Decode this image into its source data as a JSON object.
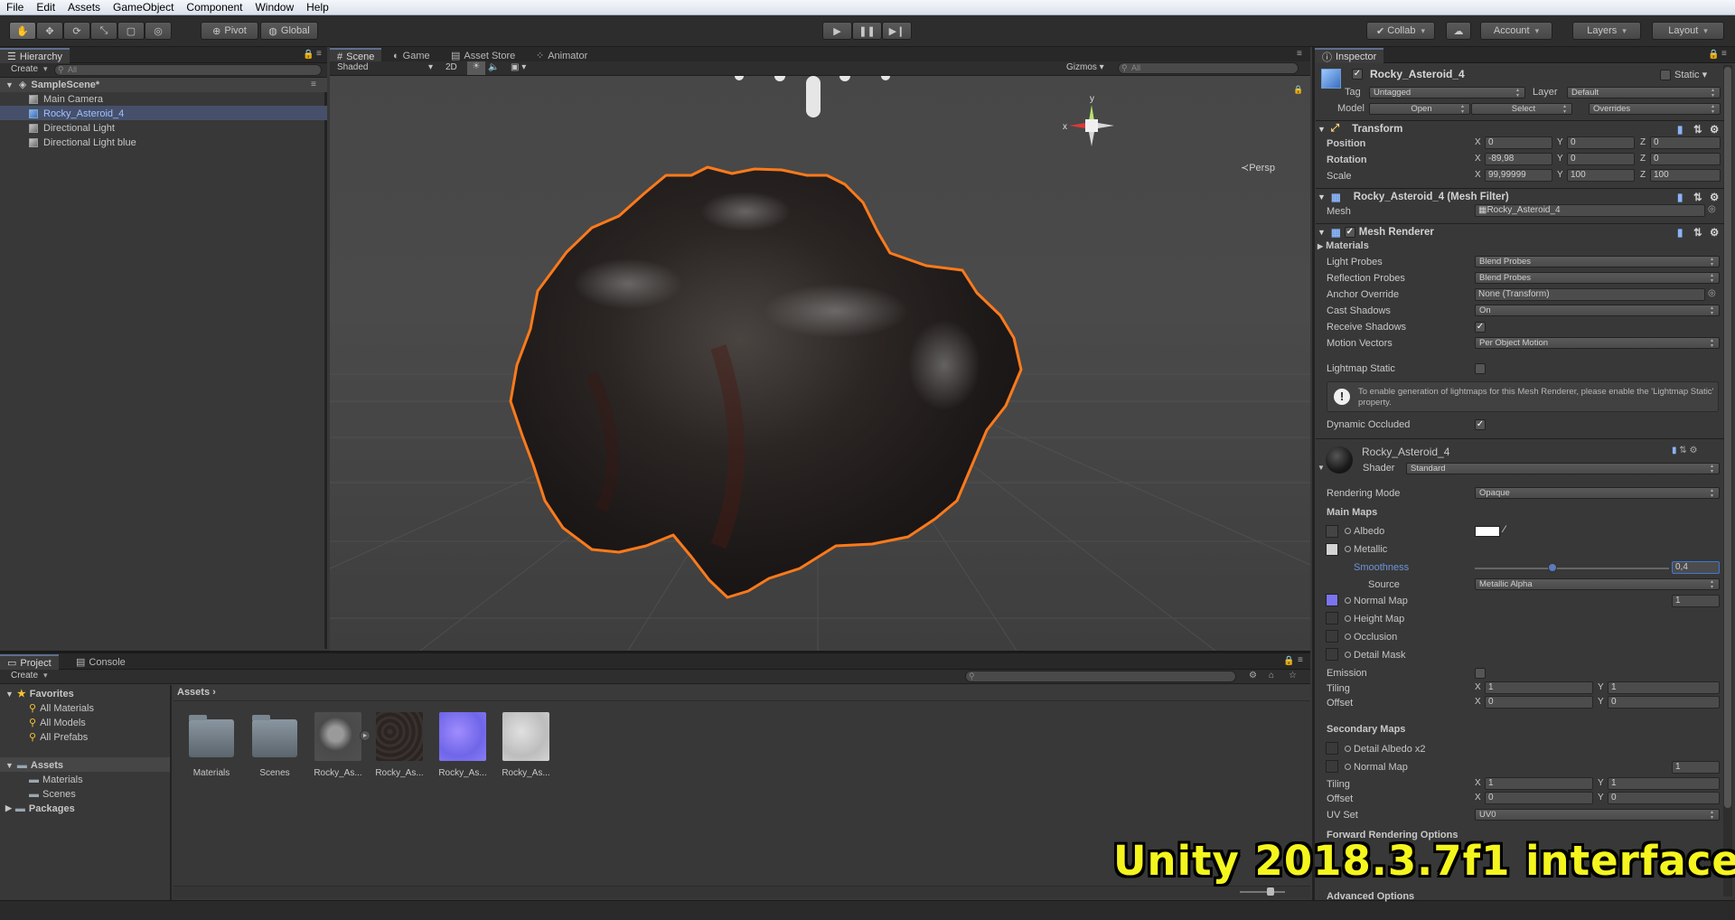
{
  "menu": [
    "File",
    "Edit",
    "Assets",
    "GameObject",
    "Component",
    "Window",
    "Help"
  ],
  "toolbar": {
    "pivot": "Pivot",
    "global": "Global",
    "collab": "Collab",
    "account": "Account",
    "layers": "Layers",
    "layout": "Layout"
  },
  "hierarchy": {
    "tab": "Hierarchy",
    "create": "Create",
    "search_placeholder": "All",
    "scene": "SampleScene*",
    "items": [
      "Main Camera",
      "Rocky_Asteroid_4",
      "Directional Light",
      "Directional Light blue"
    ]
  },
  "scene_tabs": [
    "Scene",
    "Game",
    "Asset Store",
    "Animator"
  ],
  "scene_bar": {
    "shading": "Shaded",
    "mode_2d": "2D",
    "gizmos": "Gizmos",
    "search_placeholder": "All",
    "persp": "Persp",
    "axis_x": "x",
    "axis_y": "y"
  },
  "project": {
    "tabs": [
      "Project",
      "Console"
    ],
    "create": "Create",
    "favorites_label": "Favorites",
    "favorites": [
      "All Materials",
      "All Models",
      "All Prefabs"
    ],
    "assets_label": "Assets",
    "asset_folders": [
      "Materials",
      "Scenes"
    ],
    "packages_label": "Packages",
    "breadcrumb": "Assets",
    "assets": [
      "Materials",
      "Scenes",
      "Rocky_As...",
      "Rocky_As...",
      "Rocky_As...",
      "Rocky_As..."
    ]
  },
  "inspector": {
    "tab": "Inspector",
    "object_name": "Rocky_Asteroid_4",
    "static_label": "Static",
    "tag_label": "Tag",
    "tag_value": "Untagged",
    "layer_label": "Layer",
    "layer_value": "Default",
    "model_label": "Model",
    "model_open": "Open",
    "model_select": "Select",
    "model_overrides": "Overrides",
    "transform": {
      "title": "Transform",
      "position_label": "Position",
      "position": [
        "0",
        "0",
        "0"
      ],
      "rotation_label": "Rotation",
      "rotation": [
        "-89,98",
        "0",
        "0"
      ],
      "scale_label": "Scale",
      "scale": [
        "99,99999",
        "100",
        "100"
      ]
    },
    "mesh_filter": {
      "title": "Rocky_Asteroid_4 (Mesh Filter)",
      "mesh_label": "Mesh",
      "mesh_value": "Rocky_Asteroid_4"
    },
    "mesh_renderer": {
      "title": "Mesh Renderer",
      "materials_label": "Materials",
      "light_probes_label": "Light Probes",
      "light_probes": "Blend Probes",
      "reflection_probes_label": "Reflection Probes",
      "reflection_probes": "Blend Probes",
      "anchor_override_label": "Anchor Override",
      "anchor_override": "None (Transform)",
      "cast_shadows_label": "Cast Shadows",
      "cast_shadows": "On",
      "receive_shadows_label": "Receive Shadows",
      "motion_vectors_label": "Motion Vectors",
      "motion_vectors": "Per Object Motion",
      "lightmap_static_label": "Lightmap Static",
      "help_text": "To enable generation of lightmaps for this Mesh Renderer, please enable the 'Lightmap Static' property.",
      "dynamic_occluded_label": "Dynamic Occluded"
    },
    "material": {
      "name": "Rocky_Asteroid_4",
      "shader_label": "Shader",
      "shader": "Standard",
      "rendering_mode_label": "Rendering Mode",
      "rendering_mode": "Opaque",
      "main_maps_label": "Main Maps",
      "albedo_label": "Albedo",
      "metallic_label": "Metallic",
      "smoothness_label": "Smoothness",
      "smoothness_value": "0,4",
      "smoothness_fraction": 0.4,
      "source_label": "Source",
      "source": "Metallic Alpha",
      "normal_map_label": "Normal Map",
      "normal_value": "1",
      "height_map_label": "Height Map",
      "occlusion_label": "Occlusion",
      "detail_mask_label": "Detail Mask",
      "emission_label": "Emission",
      "tiling_label": "Tiling",
      "tiling": [
        "1",
        "1"
      ],
      "offset_label": "Offset",
      "offset": [
        "0",
        "0"
      ],
      "secondary_maps_label": "Secondary Maps",
      "detail_albedo_label": "Detail Albedo x2",
      "normal_map2_label": "Normal Map",
      "normal2_value": "1",
      "tiling2": [
        "1",
        "1"
      ],
      "offset2": [
        "0",
        "0"
      ],
      "uv_set_label": "UV Set",
      "uv_set": "UV0",
      "forward_label": "Forward Rendering Options",
      "advanced_label": "Advanced Options"
    }
  },
  "caption": "Unity 2018.3.7f1 interface",
  "colors": {
    "selection_outline": "#ff7a1a",
    "caption": "#f5f51e",
    "accent_blue": "#5e6f8e"
  }
}
